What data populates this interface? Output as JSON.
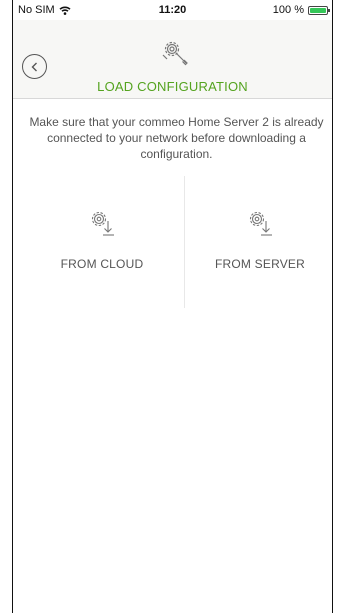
{
  "status_bar": {
    "carrier": "No SIM",
    "time": "11:20",
    "battery": "100 %",
    "battery_color": "#35c759"
  },
  "header": {
    "title": "LOAD CONFIGURATION",
    "back_icon": "chevron-left-icon",
    "icon": "gear-wrench-icon",
    "title_color": "#54a31f"
  },
  "message": "Make sure that your commeo Home Server 2 is already connected to your network before downloading a configuration.",
  "options": [
    {
      "label": "FROM CLOUD",
      "icon": "gear-download-icon"
    },
    {
      "label": "FROM SERVER",
      "icon": "gear-download-icon"
    }
  ]
}
